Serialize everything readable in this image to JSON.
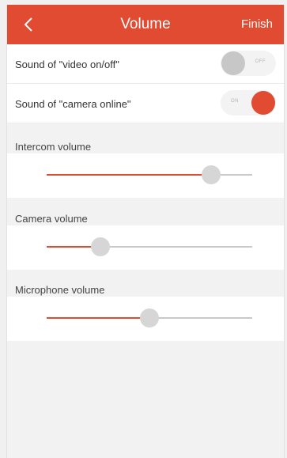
{
  "header": {
    "title": "Volume",
    "finish_label": "Finish",
    "back_icon": "chevron-left-icon"
  },
  "toggles": [
    {
      "label": "Sound of \"video on/off\"",
      "state": "off",
      "state_label": "OFF"
    },
    {
      "label": "Sound of \"camera online\"",
      "state": "on",
      "state_label": "ON"
    }
  ],
  "sliders": [
    {
      "label": "Intercom volume",
      "value": 0.8
    },
    {
      "label": "Camera volume",
      "value": 0.26
    },
    {
      "label": "Microphone volume",
      "value": 0.5
    }
  ],
  "colors": {
    "accent": "#e14b31",
    "track": "#c9c9c9",
    "thumb": "#d6d6d6"
  }
}
